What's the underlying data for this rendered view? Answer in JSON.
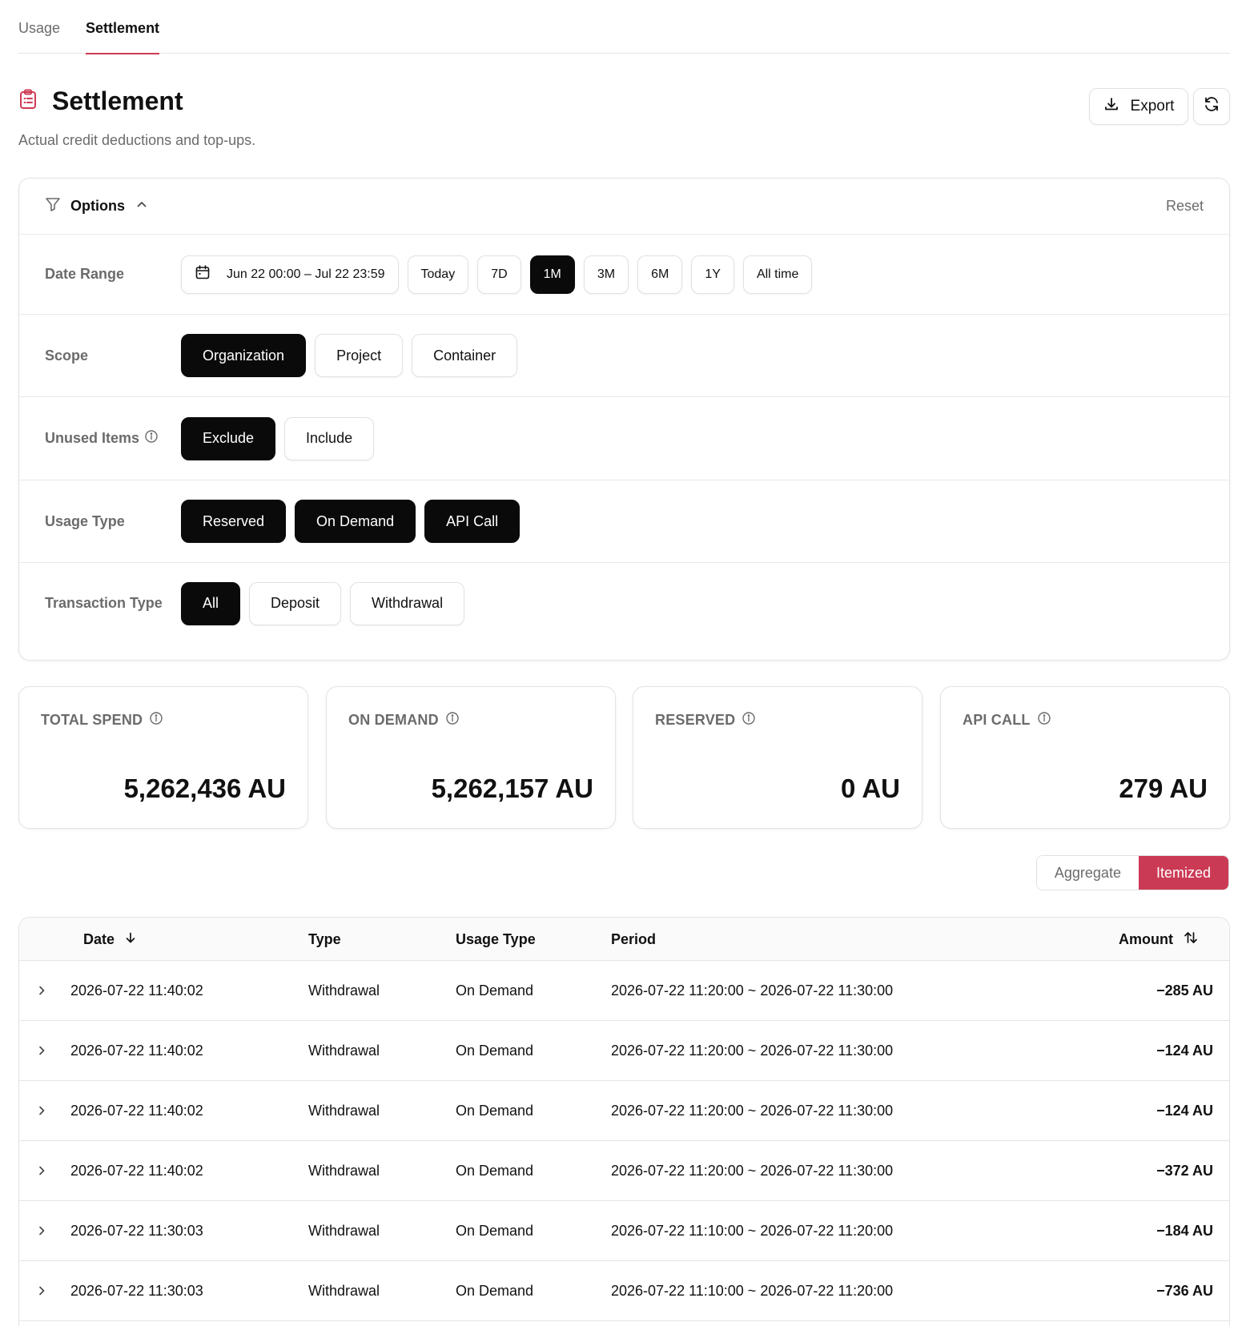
{
  "tabs": [
    {
      "label": "Usage",
      "active": false
    },
    {
      "label": "Settlement",
      "active": true
    }
  ],
  "header": {
    "title": "Settlement",
    "description": "Actual credit deductions and top-ups.",
    "export_label": "Export",
    "icon": "clipboard-list-icon",
    "accent_color": "#cf3a55"
  },
  "options": {
    "title": "Options",
    "reset_label": "Reset",
    "date_range": {
      "label": "Date Range",
      "value": "Jun 22 00:00 – Jul 22 23:59",
      "presets": [
        {
          "label": "Today",
          "selected": false
        },
        {
          "label": "7D",
          "selected": false
        },
        {
          "label": "1M",
          "selected": true
        },
        {
          "label": "3M",
          "selected": false
        },
        {
          "label": "6M",
          "selected": false
        },
        {
          "label": "1Y",
          "selected": false
        },
        {
          "label": "All time",
          "selected": false
        }
      ]
    },
    "scope": {
      "label": "Scope",
      "choices": [
        {
          "label": "Organization",
          "selected": true
        },
        {
          "label": "Project",
          "selected": false
        },
        {
          "label": "Container",
          "selected": false
        }
      ]
    },
    "unused_items": {
      "label": "Unused Items",
      "choices": [
        {
          "label": "Exclude",
          "selected": true
        },
        {
          "label": "Include",
          "selected": false
        }
      ]
    },
    "usage_type": {
      "label": "Usage Type",
      "choices": [
        {
          "label": "Reserved",
          "selected": true
        },
        {
          "label": "On Demand",
          "selected": true
        },
        {
          "label": "API Call",
          "selected": true
        }
      ]
    },
    "transaction_type": {
      "label": "Transaction Type",
      "choices": [
        {
          "label": "All",
          "selected": true
        },
        {
          "label": "Deposit",
          "selected": false
        },
        {
          "label": "Withdrawal",
          "selected": false
        }
      ]
    }
  },
  "stats": [
    {
      "label": "TOTAL SPEND",
      "value": "5,262,436 AU"
    },
    {
      "label": "ON DEMAND",
      "value": "5,262,157 AU"
    },
    {
      "label": "RESERVED",
      "value": "0 AU"
    },
    {
      "label": "API CALL",
      "value": "279 AU"
    }
  ],
  "view_toggle": {
    "aggregate_label": "Aggregate",
    "itemized_label": "Itemized",
    "selected": "Itemized"
  },
  "table": {
    "columns": {
      "date": "Date",
      "type": "Type",
      "usage_type": "Usage Type",
      "period": "Period",
      "amount": "Amount"
    },
    "rows": [
      {
        "date": "2026-07-22 11:40:02",
        "type": "Withdrawal",
        "usage_type": "On Demand",
        "period": "2026-07-22 11:20:00 ~ 2026-07-22 11:30:00",
        "amount": "−285 AU"
      },
      {
        "date": "2026-07-22 11:40:02",
        "type": "Withdrawal",
        "usage_type": "On Demand",
        "period": "2026-07-22 11:20:00 ~ 2026-07-22 11:30:00",
        "amount": "−124 AU"
      },
      {
        "date": "2026-07-22 11:40:02",
        "type": "Withdrawal",
        "usage_type": "On Demand",
        "period": "2026-07-22 11:20:00 ~ 2026-07-22 11:30:00",
        "amount": "−124 AU"
      },
      {
        "date": "2026-07-22 11:40:02",
        "type": "Withdrawal",
        "usage_type": "On Demand",
        "period": "2026-07-22 11:20:00 ~ 2026-07-22 11:30:00",
        "amount": "−372 AU"
      },
      {
        "date": "2026-07-22 11:30:03",
        "type": "Withdrawal",
        "usage_type": "On Demand",
        "period": "2026-07-22 11:10:00 ~ 2026-07-22 11:20:00",
        "amount": "−184 AU"
      },
      {
        "date": "2026-07-22 11:30:03",
        "type": "Withdrawal",
        "usage_type": "On Demand",
        "period": "2026-07-22 11:10:00 ~ 2026-07-22 11:20:00",
        "amount": "−736 AU"
      }
    ]
  }
}
